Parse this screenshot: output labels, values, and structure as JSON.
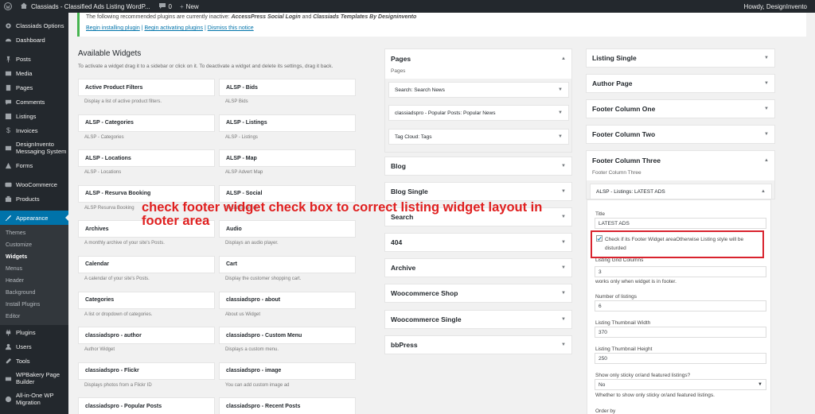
{
  "admin_bar": {
    "site_name": "Classiads - Classified Ads Listing WordP...",
    "comments_count": "0",
    "new_label": "New",
    "howdy": "Howdy, DesignInvento"
  },
  "sidebar": {
    "items": [
      {
        "label": "Classiads Options",
        "icon": "gear-icon"
      },
      {
        "label": "Dashboard",
        "icon": "dashboard-icon"
      },
      {
        "label": "Posts",
        "icon": "pin-icon"
      },
      {
        "label": "Media",
        "icon": "media-icon"
      },
      {
        "label": "Pages",
        "icon": "page-icon"
      },
      {
        "label": "Comments",
        "icon": "comment-icon"
      },
      {
        "label": "Listings",
        "icon": "listing-icon"
      },
      {
        "label": "Invoices",
        "icon": "dollar-icon"
      },
      {
        "label": "DesignInvento Messaging System",
        "icon": "message-icon"
      },
      {
        "label": "Forms",
        "icon": "forms-icon"
      },
      {
        "label": "WooCommerce",
        "icon": "woo-icon"
      },
      {
        "label": "Products",
        "icon": "products-icon"
      },
      {
        "label": "Appearance",
        "icon": "brush-icon"
      }
    ],
    "submenu": [
      "Themes",
      "Customize",
      "Widgets",
      "Menus",
      "Header",
      "Background",
      "Install Plugins",
      "Editor"
    ],
    "bottom_items": [
      {
        "label": "Plugins",
        "icon": "plugin-icon"
      },
      {
        "label": "Users",
        "icon": "users-icon"
      },
      {
        "label": "Tools",
        "icon": "tools-icon"
      },
      {
        "label": "WPBakery Page Builder",
        "icon": "wpbakery-icon"
      },
      {
        "label": "All-in-One WP Migration",
        "icon": "migration-icon"
      }
    ]
  },
  "notice": {
    "prefix": "The following recommended plugins are currently inactive: ",
    "plugin1": "AccessPress Social Login",
    "and": " and ",
    "plugin2": "Classiads Templates By Designinvento",
    "link1": "Begin installing plugin",
    "link2": "Begin activating plugins",
    "link3": "Dismiss this notice"
  },
  "available": {
    "title": "Available Widgets",
    "description": "To activate a widget drag it to a sidebar or click on it. To deactivate a widget and delete its settings, drag it back.",
    "left": [
      {
        "name": "Active Product Filters",
        "desc": "Display a list of active product filters."
      },
      {
        "name": "ALSP - Categories",
        "desc": "ALSP - Categories"
      },
      {
        "name": "ALSP - Locations",
        "desc": "ALSP - Locations"
      },
      {
        "name": "ALSP - Resurva Booking",
        "desc": "ALSP Resurva Booking"
      },
      {
        "name": "Archives",
        "desc": "A monthly archive of your site's Posts."
      },
      {
        "name": "Calendar",
        "desc": "A calendar of your site's Posts."
      },
      {
        "name": "Categories",
        "desc": "A list or dropdown of categories."
      },
      {
        "name": "classiadspro - author",
        "desc": "Author Widget"
      },
      {
        "name": "classiadspro - Flickr",
        "desc": "Displays photos from a Flickr ID"
      },
      {
        "name": "classiadspro - Popular Posts",
        "desc": ""
      }
    ],
    "right": [
      {
        "name": "ALSP - Bids",
        "desc": "ALSP Bids"
      },
      {
        "name": "ALSP - Listings",
        "desc": "ALSP - Listings"
      },
      {
        "name": "ALSP - Map",
        "desc": "ALSP Advert Map"
      },
      {
        "name": "ALSP - Social",
        "desc": "Social Services"
      },
      {
        "name": "Audio",
        "desc": "Displays an audio player."
      },
      {
        "name": "Cart",
        "desc": "Display the customer shopping cart."
      },
      {
        "name": "classiadspro - about",
        "desc": "About us Widget"
      },
      {
        "name": "classiadspro - Custom Menu",
        "desc": "Displays a custom menu."
      },
      {
        "name": "classiadspro - image",
        "desc": "You can add custom image ad"
      },
      {
        "name": "classiadspro - Recent Posts",
        "desc": ""
      }
    ]
  },
  "mid_sidebars": {
    "pages": {
      "title": "Pages",
      "desc": "Pages"
    },
    "pages_widgets": [
      {
        "prefix": "Search:",
        "name": "Search News"
      },
      {
        "prefix": "classiadspro - Popular Posts:",
        "name": "Popular News"
      },
      {
        "prefix": "Tag Cloud:",
        "name": "Tags"
      }
    ],
    "closed": [
      "Blog",
      "Blog Single",
      "Search",
      "404",
      "Archive",
      "Woocommerce Shop",
      "Woocommerce Single",
      "bbPress"
    ]
  },
  "right_sidebars": {
    "closed": [
      "Listing Single",
      "Author Page",
      "Footer Column One",
      "Footer Column Two"
    ],
    "open": {
      "title": "Footer Column Three",
      "desc": "Footer Column Three"
    },
    "open_widget": {
      "prefix": "ALSP - Listings:",
      "name": "LATEST ADS"
    }
  },
  "form": {
    "title_label": "Title",
    "title_value": "LATEST ADS",
    "checkbox_label": "Check if its Footer Widget area",
    "checkbox_hint": "Otherwise Listing style will be disturded",
    "grid_label": "Listing Grid Columns",
    "grid_value": "3",
    "grid_hint": "works only when widget is in footer.",
    "num_label": "Number of listings",
    "num_value": "6",
    "thumb_w_label": "Listing Thumbnail Width",
    "thumb_w_value": "370",
    "thumb_h_label": "Listing Thumbnail Height",
    "thumb_h_value": "250",
    "sticky_label": "Show only sticky or/and featured listings?",
    "sticky_value": "No",
    "sticky_hint": "Whether to show only sticky or/and featured listings.",
    "order_label": "Order by"
  },
  "overlay": {
    "text": "check footer widget check box to correct listing widget layout in footer area",
    "color": "#e02020"
  },
  "colors": {
    "admin_bar": "#23282d",
    "accent": "#0073aa",
    "notice_border": "#46b450",
    "highlight": "#d9232e"
  }
}
